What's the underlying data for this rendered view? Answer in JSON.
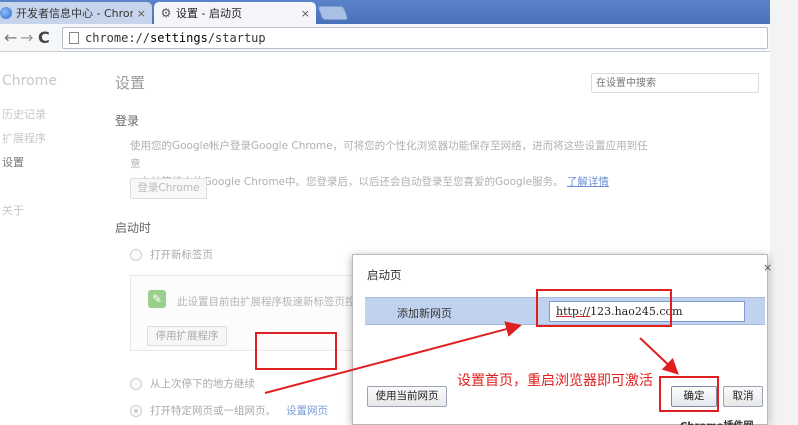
{
  "tabs": [
    {
      "title": "开发者信息中心 - Chrome",
      "close": "×",
      "icon": "globe-icon"
    },
    {
      "title": "设置 - 启动页",
      "close": "×",
      "icon": "gear-icon"
    }
  ],
  "toolbar": {
    "back": "←",
    "forward": "→",
    "reload": "C",
    "url_scheme": "chrome://",
    "url_host": "settings",
    "url_path": "/startup"
  },
  "sidebar": {
    "brand": "Chrome",
    "items": [
      {
        "label": "历史记录"
      },
      {
        "label": "扩展程序"
      },
      {
        "label": "设置"
      },
      {
        "label": "关于"
      }
    ]
  },
  "settings": {
    "title": "设置",
    "search_placeholder": "在设置中搜索",
    "signin": {
      "title": "登录",
      "desc_line1": "使用您的Google帐户登录Google Chrome，可将您的个性化浏览器功能保存至网络，进而将这些设置应用到任意",
      "desc_line2": "一台计算机上的Google Chrome中。您登录后，以后还会自动登录至您喜爱的Google服务。",
      "learn_more": "了解详情",
      "button": "登录Chrome"
    },
    "startup": {
      "title": "启动时",
      "open_new_tab": "打开新标签页",
      "extension_text": "此设置目前由扩展程序极速新标签页控制",
      "disable_extension": "停用扩展程序",
      "continue_where_left": "从上次停下的地方继续",
      "open_specific": "打开特定网页或一组网页。",
      "set_pages": "设置网页"
    }
  },
  "dialog": {
    "title": "启动页",
    "close": "×",
    "add_new_page": "添加新网页",
    "url_value_prefix": "http://",
    "url_value_rest": "123.hao245.com",
    "use_current": "使用当前网页",
    "ok": "确定",
    "cancel": "取消"
  },
  "annotation": {
    "text": "设置首页，重启浏览器即可激活",
    "color": "#e02020"
  },
  "bottom_text": "Chrome插件网"
}
